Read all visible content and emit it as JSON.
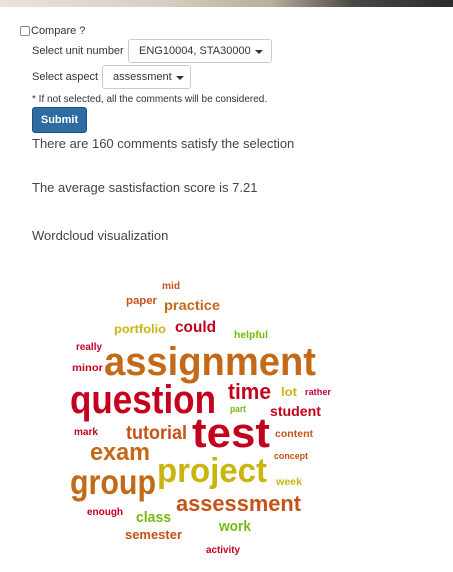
{
  "form": {
    "compare_label": "Compare ?",
    "unit_label": "Select unit number",
    "unit_value": "ENG10004, STA30000",
    "aspect_label": "Select aspect",
    "aspect_value": "assessment",
    "note": "* If not selected, all the comments will be considered.",
    "submit_label": "Submit"
  },
  "results": {
    "count_text": "There are 160 comments satisfy the selection",
    "avg_text": "The average sastisfaction score is 7.21",
    "wordcloud_title": "Wordcloud visualization"
  },
  "colors": {
    "brown": "#c26a17",
    "red": "#c4001f",
    "olive": "#c8b50e",
    "green": "#74bb10",
    "crimson": "#c0033f",
    "dark_orange": "#c65218"
  },
  "wordcloud": {
    "words": [
      {
        "text": "mid",
        "color": "#c65218"
      },
      {
        "text": "paper",
        "color": "#c65218"
      },
      {
        "text": "practice",
        "color": "#c26a17"
      },
      {
        "text": "portfolio",
        "color": "#c8b50e"
      },
      {
        "text": "could",
        "color": "#c4001f"
      },
      {
        "text": "helpful",
        "color": "#74bb10"
      },
      {
        "text": "really",
        "color": "#c4001f"
      },
      {
        "text": "assignment",
        "color": "#c26a17"
      },
      {
        "text": "minor",
        "color": "#c4001f"
      },
      {
        "text": "question",
        "color": "#c4001f"
      },
      {
        "text": "time",
        "color": "#c4001f"
      },
      {
        "text": "lot",
        "color": "#c8b50e"
      },
      {
        "text": "rather",
        "color": "#c0033f"
      },
      {
        "text": "part",
        "color": "#74bb10"
      },
      {
        "text": "student",
        "color": "#c4001f"
      },
      {
        "text": "mark",
        "color": "#c4001f"
      },
      {
        "text": "tutorial",
        "color": "#c65218"
      },
      {
        "text": "test",
        "color": "#c4001f"
      },
      {
        "text": "content",
        "color": "#c65218"
      },
      {
        "text": "exam",
        "color": "#c26a17"
      },
      {
        "text": "concept",
        "color": "#c65218"
      },
      {
        "text": "project",
        "color": "#c8b50e"
      },
      {
        "text": "group",
        "color": "#c26a17"
      },
      {
        "text": "week",
        "color": "#c8b50e"
      },
      {
        "text": "assessment",
        "color": "#c65218"
      },
      {
        "text": "enough",
        "color": "#c4001f"
      },
      {
        "text": "class",
        "color": "#74bb10"
      },
      {
        "text": "work",
        "color": "#74bb10"
      },
      {
        "text": "semester",
        "color": "#c65218"
      },
      {
        "text": "activity",
        "color": "#c4001f"
      }
    ]
  }
}
